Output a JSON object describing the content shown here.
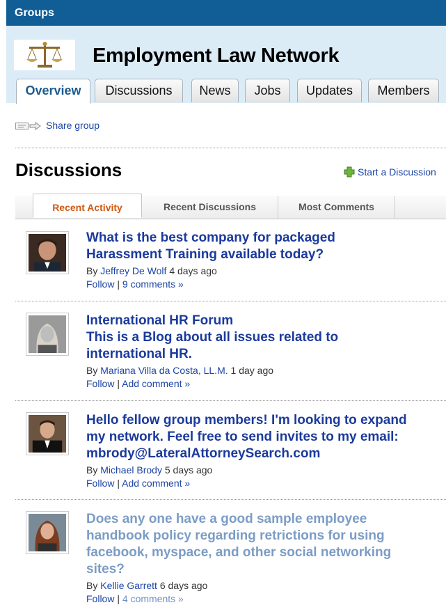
{
  "topbar": {
    "title": "Groups"
  },
  "group": {
    "name": "Employment Law Network"
  },
  "tabs": [
    "Overview",
    "Discussions",
    "News",
    "Jobs",
    "Updates",
    "Members"
  ],
  "share": {
    "label": "Share group"
  },
  "discussions": {
    "heading": "Discussions",
    "start_label": "Start a Discussion",
    "subtabs": [
      "Recent Activity",
      "Recent Discussions",
      "Most Comments"
    ]
  },
  "posts": [
    {
      "title_lines": [
        "What is the best company for packaged",
        "Harassment Training available today?"
      ],
      "by": "By",
      "author": "Jeffrey De Wolf",
      "age": "4 days ago",
      "follow": "Follow",
      "sep": "|",
      "comments": "9 comments »"
    },
    {
      "title_lines": [
        "International HR Forum",
        "This is a Blog about all issues related to",
        "international HR."
      ],
      "by": "By",
      "author": "Mariana Villa da Costa, LL.M.",
      "age": "1 day ago",
      "follow": "Follow",
      "sep": "|",
      "comments": "Add comment »"
    },
    {
      "title_lines": [
        "Hello fellow group members! I'm looking to expand",
        "my network. Feel free to send invites to my email:",
        "mbrody@LateralAttorneySearch.com"
      ],
      "by": "By",
      "author": "Michael Brody",
      "age": "5 days ago",
      "follow": "Follow",
      "sep": "|",
      "comments": "Add comment »"
    },
    {
      "title_lines": [
        "Does any one have a good sample employee",
        "handbook policy regarding retrictions for using",
        "facebook, myspace, and other social networking",
        "sites?"
      ],
      "by": "By",
      "author": "Kellie Garrett",
      "age": "6 days ago",
      "follow": "Follow",
      "sep": "|",
      "comments": "4 comments »"
    }
  ],
  "colors": {
    "topbar": "#115e97",
    "header_bg": "#dcecf7",
    "link": "#1c44a5",
    "post_title": "#1b3a9c",
    "visited": "#7c9cc5",
    "active_subtab": "#cc5a16"
  }
}
